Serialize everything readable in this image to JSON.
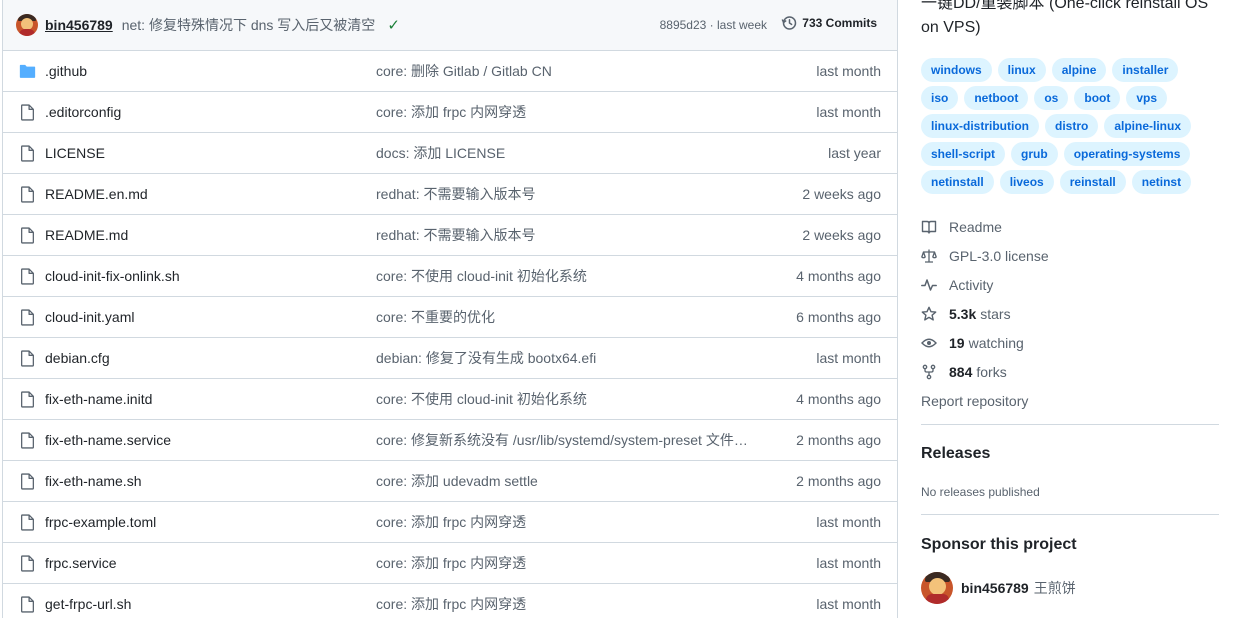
{
  "commit": {
    "user": "bin456789",
    "message": "net: 修复特殊情况下 dns 写入后又被清空",
    "check": "✓",
    "meta": "8895d23 · last week",
    "commits_label": "733 Commits"
  },
  "files": [
    {
      "name": ".github",
      "type": "folder",
      "message": "core: 删除 Gitlab / Gitlab CN",
      "time": "last month"
    },
    {
      "name": ".editorconfig",
      "type": "file",
      "message": "core: 添加 frpc 内网穿透",
      "time": "last month"
    },
    {
      "name": "LICENSE",
      "type": "file",
      "message": "docs: 添加 LICENSE",
      "time": "last year"
    },
    {
      "name": "README.en.md",
      "type": "file",
      "message": "redhat: 不需要输入版本号",
      "time": "2 weeks ago"
    },
    {
      "name": "README.md",
      "type": "file",
      "message": "redhat: 不需要输入版本号",
      "time": "2 weeks ago"
    },
    {
      "name": "cloud-init-fix-onlink.sh",
      "type": "file",
      "message": "core: 不使用 cloud-init 初始化系统",
      "time": "4 months ago"
    },
    {
      "name": "cloud-init.yaml",
      "type": "file",
      "message": "core: 不重要的优化",
      "time": "6 months ago"
    },
    {
      "name": "debian.cfg",
      "type": "file",
      "message": "debian: 修复了没有生成 bootx64.efi",
      "time": "last month"
    },
    {
      "name": "fix-eth-name.initd",
      "type": "file",
      "message": "core: 不使用 cloud-init 初始化系统",
      "time": "4 months ago"
    },
    {
      "name": "fix-eth-name.service",
      "type": "file",
      "message": "core: 修复新系统没有 /usr/lib/systemd/system-preset 文件…",
      "time": "2 months ago"
    },
    {
      "name": "fix-eth-name.sh",
      "type": "file",
      "message": "core: 添加 udevadm settle",
      "time": "2 months ago"
    },
    {
      "name": "frpc-example.toml",
      "type": "file",
      "message": "core: 添加 frpc 内网穿透",
      "time": "last month"
    },
    {
      "name": "frpc.service",
      "type": "file",
      "message": "core: 添加 frpc 内网穿透",
      "time": "last month"
    },
    {
      "name": "get-frpc-url.sh",
      "type": "file",
      "message": "core: 添加 frpc 内网穿透",
      "time": "last month"
    }
  ],
  "about": {
    "description": "一键DD/重装脚本 (One-click reinstall OS on VPS)",
    "topics": [
      "windows",
      "linux",
      "alpine",
      "installer",
      "iso",
      "netboot",
      "os",
      "boot",
      "vps",
      "linux-distribution",
      "distro",
      "alpine-linux",
      "shell-script",
      "grub",
      "operating-systems",
      "netinstall",
      "liveos",
      "reinstall",
      "netinst"
    ]
  },
  "meta": {
    "readme": "Readme",
    "license": "GPL-3.0 license",
    "activity": "Activity",
    "stars_count": "5.3k",
    "stars_label": "stars",
    "watching_count": "19",
    "watching_label": "watching",
    "forks_count": "884",
    "forks_label": "forks",
    "report": "Report repository"
  },
  "releases": {
    "title": "Releases",
    "subtitle": "No releases published"
  },
  "sponsor": {
    "title": "Sponsor this project",
    "user": "bin456789",
    "full_name": "王煎饼"
  },
  "colors": {
    "link": "#0969da",
    "topic_bg": "#ddf4ff",
    "folder": "#54aeff",
    "muted": "#59636e",
    "success": "#1a7f37"
  }
}
